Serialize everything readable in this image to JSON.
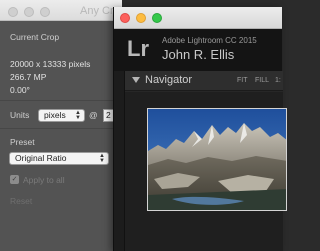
{
  "crop_window": {
    "title": "Any Cr",
    "current_crop_label": "Current Crop",
    "dimensions": "20000 x 13333 pixels",
    "megapixels": "266.7 MP",
    "angle": "0.00°",
    "units_label": "Units",
    "units_value": "pixels",
    "at_sign": "@",
    "resolution_value": "2",
    "preset_label": "Preset",
    "preset_value": "Original Ratio",
    "apply_to_all_label": "Apply to all",
    "apply_to_all_checked": true,
    "reset_label": "Reset"
  },
  "lightroom": {
    "logo": "Lr",
    "product": "Adobe Lightroom CC 2015",
    "user_name": "John R. Ellis",
    "navigator": {
      "title": "Navigator",
      "options": [
        "FIT",
        "FILL",
        "1:"
      ]
    }
  },
  "colors": {
    "close": "#fc605c",
    "minimize": "#fdbc40",
    "zoom": "#34c84a",
    "panel_bg": "#535353",
    "lr_bg": "#1c1c1c"
  }
}
